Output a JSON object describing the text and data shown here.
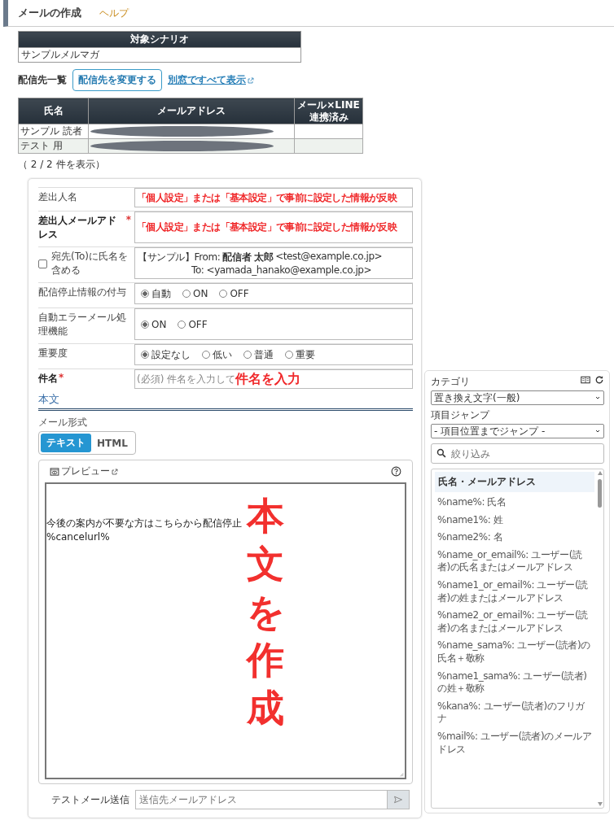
{
  "header": {
    "title": "メールの作成",
    "help_link": "ヘルプ"
  },
  "scenario_table": {
    "heading": "対象シナリオ",
    "value": "サンプルメルマガ"
  },
  "recipients": {
    "label": "配信先一覧",
    "change_button": "配信先を変更する",
    "show_all_link": "別窓ですべて表示",
    "columns": [
      "氏名",
      "メールアドレス",
      "メール×LINE\n連携済み"
    ],
    "rows": [
      {
        "name": "サンプル 読者",
        "email_redacted": true
      },
      {
        "name": "テスト 用",
        "email_redacted": true
      }
    ],
    "count": "（ 2 / 2 件を表示）"
  },
  "form": {
    "rows": [
      {
        "kind": "text",
        "label": "差出人名",
        "required": false,
        "annotation": "「個人設定」または「基本設定」で事前に設定した情報が反映"
      },
      {
        "kind": "text",
        "label": "差出人メールアドレス",
        "required": true,
        "annotation": "「個人設定」または「基本設定」で事前に設定した情報が反映"
      },
      {
        "kind": "checkbox",
        "label": "宛先(To)に氏名を含める",
        "checked": false,
        "preview_prefix": "【サンプル】From:",
        "preview_sender": "配信者 太郎",
        "preview_from": "<test@example.co.jp>",
        "preview_to_label": "To:",
        "preview_to": "<yamada_hanako@example.co.jp>"
      },
      {
        "kind": "radio",
        "label": "配信停止情報の付与",
        "options": [
          {
            "label": "自動",
            "selected": true
          },
          {
            "label": "ON",
            "selected": false
          },
          {
            "label": "OFF",
            "selected": false
          }
        ]
      },
      {
        "kind": "radio",
        "label": "自動エラーメール処理機能",
        "options": [
          {
            "label": "ON",
            "selected": true
          },
          {
            "label": "OFF",
            "selected": false
          }
        ]
      },
      {
        "kind": "radio",
        "label": "重要度",
        "options": [
          {
            "label": "設定なし",
            "selected": true
          },
          {
            "label": "低い",
            "selected": false
          },
          {
            "label": "普通",
            "selected": false
          },
          {
            "label": "重要",
            "selected": false
          }
        ]
      },
      {
        "kind": "subject",
        "label": "件名",
        "required": true,
        "placeholder": "(必須) 件名を入力して",
        "annotation": "件名を入力"
      }
    ],
    "required_mark": "*",
    "body_heading": "本文",
    "format_label": "メール形式",
    "formats": [
      {
        "label": "テキスト",
        "selected": true
      },
      {
        "label": "HTML",
        "selected": false
      }
    ],
    "preview_button": "プレビュー",
    "body_lines": [
      "今後の案内が不要な方はこちらから配信停止",
      "%cancelurl%"
    ],
    "body_annotation": "本文を作成",
    "test_send_label": "テストメール送信",
    "test_send_placeholder": "送信先メールアドレス"
  },
  "side_panel": {
    "category_label": "カテゴリ",
    "category_value": "置き換え文字(一般)",
    "jump_label": "項目ジャンプ",
    "jump_value": "- 項目位置までジャンプ -",
    "filter_placeholder": "絞り込み",
    "items": [
      {
        "kind": "header",
        "text": "氏名・メールアドレス"
      },
      {
        "kind": "item",
        "text": "%name%: 氏名"
      },
      {
        "kind": "item",
        "text": "%name1%: 姓"
      },
      {
        "kind": "item",
        "text": "%name2%: 名"
      },
      {
        "kind": "item",
        "text": "%name_or_email%: ユーザー(読者)の氏名またはメールアドレス"
      },
      {
        "kind": "item",
        "text": "%name1_or_email%: ユーザー(読者)の姓またはメールアドレス"
      },
      {
        "kind": "item",
        "text": "%name2_or_email%: ユーザー(読者)の名またはメールアドレス"
      },
      {
        "kind": "item",
        "text": "%name_sama%: ユーザー(読者)の氏名＋敬称"
      },
      {
        "kind": "item",
        "text": "%name1_sama%: ユーザー(読者)の姓＋敬称"
      },
      {
        "kind": "item",
        "text": "%kana%: ユーザー(読者)のフリガナ"
      },
      {
        "kind": "item",
        "text": "%mail%: ユーザー(読者)のメールアドレス"
      }
    ]
  }
}
